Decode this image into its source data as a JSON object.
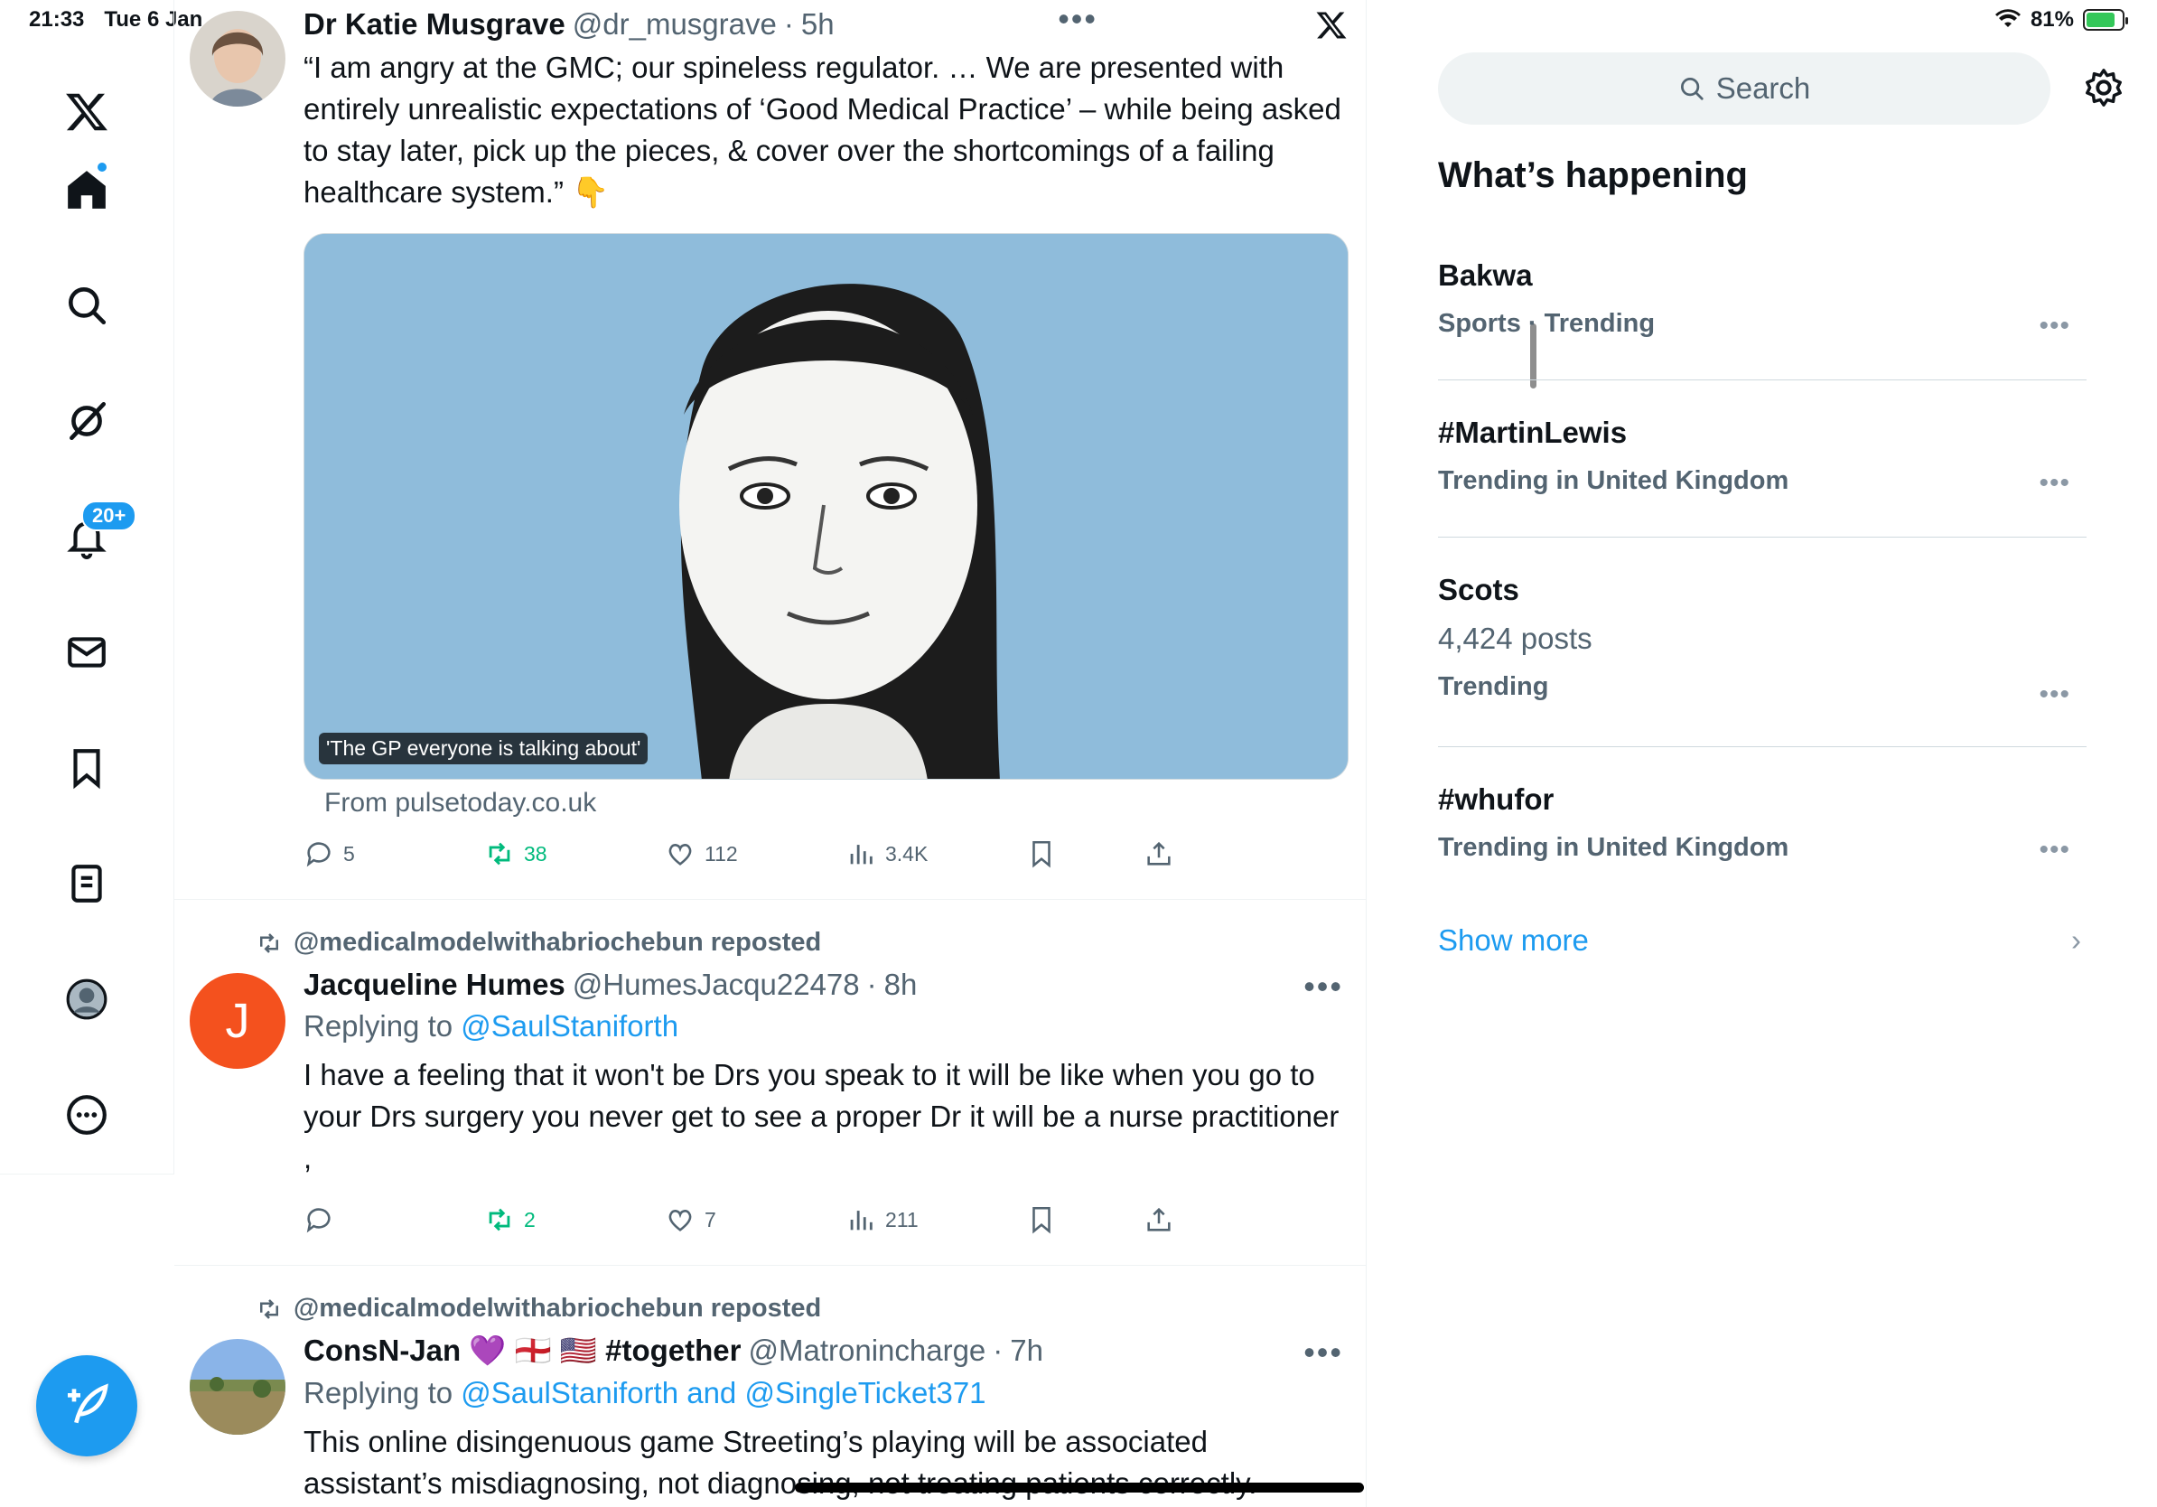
{
  "status_bar": {
    "time": "21:33",
    "date": "Tue 6 Jan",
    "battery": "81%",
    "battery_level": 0.81
  },
  "nav": {
    "notifications_badge": "20+"
  },
  "feed": {
    "post1": {
      "author": "Dr Katie Musgrave",
      "handle": "@dr_musgrave",
      "time": "5h",
      "text": "“I am angry at the GMC; our spineless regulator. … We are presented with entirely unrealistic expectations of ‘Good Medical Practice’ – while being asked to stay later, pick up the pieces, & cover over the shortcomings of a failing healthcare system.” 👇",
      "card_caption": "'The GP everyone is talking about'",
      "card_source": "From pulsetoday.co.uk",
      "replies": "5",
      "reposts": "38",
      "likes": "112",
      "views": "3.4K"
    },
    "post2": {
      "repost_by": "@medicalmodelwithabriochebun reposted",
      "avatar_letter": "J",
      "author": "Jacqueline Humes",
      "handle": "@HumesJacqu22478",
      "time": "8h",
      "replying_prefix": "Replying to ",
      "replying_to": "@SaulStaniforth",
      "text": "I have a feeling that it won't be Drs you speak to it will be like when you go to your Drs surgery you never get to see a proper Dr it will be a nurse practitioner ,",
      "replies": "",
      "reposts": "2",
      "likes": "7",
      "views": "211"
    },
    "post3": {
      "repost_by": "@medicalmodelwithabriochebun reposted",
      "author": "ConsN-Jan 💜 🏴󠁧󠁢󠁥󠁮󠁧󠁿 🇺🇸 #together",
      "handle": "@Matronincharge",
      "time": "7h",
      "replying_prefix": "Replying to ",
      "replying_to": "@SaulStaniforth and @SingleTicket371",
      "text": "This online disingenuous game Streeting’s playing will be associated assistant’s misdiagnosing, not diagnosing, not treating patients correctly."
    }
  },
  "right": {
    "search_placeholder": "Search",
    "section_title": "What’s happening",
    "trends": [
      {
        "name": "Bakwa",
        "meta": "Sports · Trending"
      },
      {
        "name": "#MartinLewis",
        "meta": "Trending in United Kingdom"
      },
      {
        "name": "Scots",
        "posts": "4,424 posts",
        "meta": "Trending"
      },
      {
        "name": "#whufor",
        "meta": "Trending in United Kingdom"
      }
    ],
    "show_more": "Show more"
  },
  "colors": {
    "accent": "#1d9bf0",
    "repost_green": "#00ba7c",
    "secondary_text": "#536471",
    "card_bg": "#8fbcdb"
  },
  "icons": [
    "x-logo",
    "home-icon",
    "search-icon",
    "grok-icon",
    "bell-icon",
    "mail-icon",
    "bookmark-icon",
    "lists-icon",
    "profile-icon",
    "more-icon",
    "compose-icon",
    "reply-icon",
    "repost-icon",
    "like-icon",
    "views-icon",
    "share-icon",
    "gear-icon",
    "wifi-icon",
    "battery-icon"
  ]
}
